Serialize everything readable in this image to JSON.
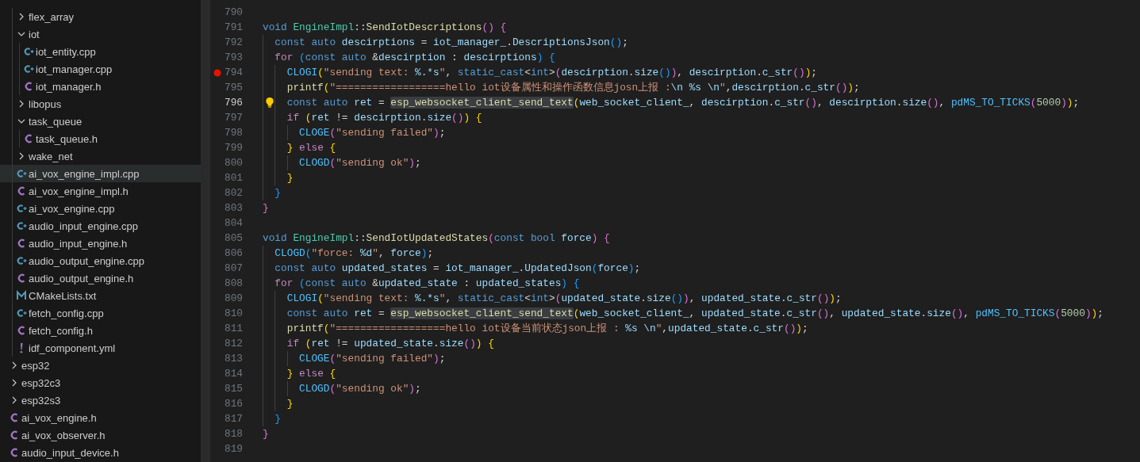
{
  "explorer": {
    "open_folder_children": [
      {
        "kind": "folder",
        "label": "flex_array",
        "expanded": false,
        "selected": false
      },
      {
        "kind": "folder",
        "label": "iot",
        "expanded": true,
        "selected": false,
        "children": [
          {
            "kind": "cpp",
            "label": "iot_entity.cpp",
            "selected": false
          },
          {
            "kind": "cpp",
            "label": "iot_manager.cpp",
            "selected": false
          },
          {
            "kind": "h",
            "label": "iot_manager.h",
            "selected": false
          }
        ]
      },
      {
        "kind": "folder",
        "label": "libopus",
        "expanded": false,
        "selected": false
      },
      {
        "kind": "folder",
        "label": "task_queue",
        "expanded": true,
        "selected": false,
        "children": [
          {
            "kind": "h",
            "label": "task_queue.h",
            "selected": false
          }
        ]
      },
      {
        "kind": "folder",
        "label": "wake_net",
        "expanded": false,
        "selected": false
      },
      {
        "kind": "cpp",
        "label": "ai_vox_engine_impl.cpp",
        "selected": true
      },
      {
        "kind": "h",
        "label": "ai_vox_engine_impl.h",
        "selected": false
      },
      {
        "kind": "cpp",
        "label": "ai_vox_engine.cpp",
        "selected": false
      },
      {
        "kind": "cpp",
        "label": "audio_input_engine.cpp",
        "selected": false
      },
      {
        "kind": "h",
        "label": "audio_input_engine.h",
        "selected": false
      },
      {
        "kind": "cpp",
        "label": "audio_output_engine.cpp",
        "selected": false
      },
      {
        "kind": "h",
        "label": "audio_output_engine.h",
        "selected": false
      },
      {
        "kind": "cmake",
        "label": "CMakeLists.txt",
        "selected": false
      },
      {
        "kind": "cpp",
        "label": "fetch_config.cpp",
        "selected": false
      },
      {
        "kind": "h",
        "label": "fetch_config.h",
        "selected": false
      },
      {
        "kind": "yml",
        "label": "idf_component.yml",
        "selected": false
      }
    ],
    "items": [
      {
        "kind": "folder",
        "label": "esp32",
        "expanded": false,
        "selected": false
      },
      {
        "kind": "folder",
        "label": "esp32c3",
        "expanded": false,
        "selected": false
      },
      {
        "kind": "folder",
        "label": "esp32s3",
        "expanded": false,
        "selected": false
      },
      {
        "kind": "h",
        "label": "ai_vox_engine.h",
        "selected": false
      },
      {
        "kind": "h",
        "label": "ai_vox_observer.h",
        "selected": false
      },
      {
        "kind": "h",
        "label": "audio_input_device.h",
        "selected": false
      }
    ]
  },
  "editor": {
    "lines": [
      {
        "n": "790",
        "breakpoint": false,
        "lightbulb": false,
        "current": false
      },
      {
        "n": "791",
        "breakpoint": false,
        "lightbulb": false,
        "current": false,
        "tokens": [
          {
            "kind": "s",
            "text": "void "
          },
          {
            "kind": "c",
            "text": "EngineImpl"
          },
          {
            "kind": "p",
            "text": "::"
          },
          {
            "kind": "f",
            "text": "SendIotDescriptions"
          },
          {
            "kind": "p",
            "text": "() {"
          }
        ]
      },
      {
        "n": "792",
        "breakpoint": false,
        "lightbulb": false,
        "current": false,
        "tokens": [
          {
            "kind": "s",
            "text": "  const "
          },
          {
            "kind": "s",
            "text": "auto "
          },
          {
            "kind": "v",
            "text": "descirptions"
          },
          {
            "kind": "p",
            "text": " = "
          },
          {
            "kind": "v",
            "text": "iot_manager_"
          },
          {
            "kind": "p",
            "text": "."
          },
          {
            "kind": "v",
            "text": "DescriptionsJson"
          },
          {
            "kind": "p",
            "text": "();"
          }
        ]
      },
      {
        "n": "793",
        "breakpoint": false,
        "lightbulb": false,
        "current": false,
        "tokens": [
          {
            "kind": "k",
            "text": "  for"
          },
          {
            "kind": "p",
            "text": " ("
          },
          {
            "kind": "s",
            "text": "const "
          },
          {
            "kind": "s",
            "text": "auto "
          },
          {
            "kind": "p",
            "text": "&"
          },
          {
            "kind": "v",
            "text": "descirption"
          },
          {
            "kind": "p",
            "text": " : "
          },
          {
            "kind": "v",
            "text": "descirptions"
          },
          {
            "kind": "p",
            "text": ") {"
          }
        ]
      },
      {
        "n": "794",
        "breakpoint": true,
        "lightbulb": false,
        "current": false,
        "tokens": [
          {
            "kind": "m",
            "text": "    CLOGI"
          },
          {
            "kind": "p",
            "text": "("
          },
          {
            "kind": "str",
            "text": "\"sending text: "
          },
          {
            "kind": "esc",
            "text": "%.*s"
          },
          {
            "kind": "str",
            "text": "\""
          },
          {
            "kind": "p",
            "text": ", "
          },
          {
            "kind": "s",
            "text": "static_cast"
          },
          {
            "kind": "p",
            "text": "<"
          },
          {
            "kind": "s",
            "text": "int"
          },
          {
            "kind": "p",
            "text": ">("
          },
          {
            "kind": "v",
            "text": "descirption"
          },
          {
            "kind": "p",
            "text": "."
          },
          {
            "kind": "v",
            "text": "size"
          },
          {
            "kind": "p",
            "text": "()), "
          },
          {
            "kind": "v",
            "text": "descirption"
          },
          {
            "kind": "p",
            "text": "."
          },
          {
            "kind": "v",
            "text": "c_str"
          },
          {
            "kind": "p",
            "text": "());"
          }
        ]
      },
      {
        "n": "795",
        "breakpoint": false,
        "lightbulb": false,
        "current": false,
        "tokens": [
          {
            "kind": "f",
            "text": "    printf"
          },
          {
            "kind": "p",
            "text": "("
          },
          {
            "kind": "str",
            "text": "\"==================hello iot设备属性和操作函数信息josn上报 :"
          },
          {
            "kind": "esc",
            "text": "\\n %s \\n"
          },
          {
            "kind": "str",
            "text": "\""
          },
          {
            "kind": "p",
            "text": ","
          },
          {
            "kind": "v",
            "text": "descirption"
          },
          {
            "kind": "p",
            "text": "."
          },
          {
            "kind": "v",
            "text": "c_str"
          },
          {
            "kind": "p",
            "text": "());"
          }
        ]
      },
      {
        "n": "796",
        "breakpoint": false,
        "lightbulb": true,
        "current": true,
        "tokens": [
          {
            "kind": "s",
            "text": "    const "
          },
          {
            "kind": "s",
            "text": "auto "
          },
          {
            "kind": "v",
            "text": "ret"
          },
          {
            "kind": "p",
            "text": " = "
          },
          {
            "kind": "h",
            "text": "esp_websocket_client_send_text"
          },
          {
            "kind": "p",
            "text": "("
          },
          {
            "kind": "v",
            "text": "web_socket_client_"
          },
          {
            "kind": "p",
            "text": ", "
          },
          {
            "kind": "v",
            "text": "descirption"
          },
          {
            "kind": "p",
            "text": "."
          },
          {
            "kind": "v",
            "text": "c_str"
          },
          {
            "kind": "p",
            "text": "(), "
          },
          {
            "kind": "v",
            "text": "descirption"
          },
          {
            "kind": "p",
            "text": "."
          },
          {
            "kind": "v",
            "text": "size"
          },
          {
            "kind": "p",
            "text": "(), "
          },
          {
            "kind": "m",
            "text": "pdMS_TO_TICKS"
          },
          {
            "kind": "p",
            "text": "("
          },
          {
            "kind": "n",
            "text": "5000"
          },
          {
            "kind": "p",
            "text": "));"
          }
        ]
      },
      {
        "n": "797",
        "breakpoint": false,
        "lightbulb": false,
        "current": false,
        "tokens": [
          {
            "kind": "k",
            "text": "    if"
          },
          {
            "kind": "p",
            "text": " ("
          },
          {
            "kind": "v",
            "text": "ret"
          },
          {
            "kind": "p",
            "text": " != "
          },
          {
            "kind": "v",
            "text": "descirption"
          },
          {
            "kind": "p",
            "text": "."
          },
          {
            "kind": "v",
            "text": "size"
          },
          {
            "kind": "p",
            "text": "()) {"
          }
        ]
      },
      {
        "n": "798",
        "breakpoint": false,
        "lightbulb": false,
        "current": false,
        "tokens": [
          {
            "kind": "m",
            "text": "      CLOGE"
          },
          {
            "kind": "p",
            "text": "("
          },
          {
            "kind": "str",
            "text": "\"sending failed\""
          },
          {
            "kind": "p",
            "text": ");"
          }
        ]
      },
      {
        "n": "799",
        "breakpoint": false,
        "lightbulb": false,
        "current": false,
        "tokens": [
          {
            "kind": "p",
            "text": "    } "
          },
          {
            "kind": "k",
            "text": "else"
          },
          {
            "kind": "p",
            "text": " {"
          }
        ]
      },
      {
        "n": "800",
        "breakpoint": false,
        "lightbulb": false,
        "current": false,
        "tokens": [
          {
            "kind": "m",
            "text": "      CLOGD"
          },
          {
            "kind": "p",
            "text": "("
          },
          {
            "kind": "str",
            "text": "\"sending ok\""
          },
          {
            "kind": "p",
            "text": ");"
          }
        ]
      },
      {
        "n": "801",
        "breakpoint": false,
        "lightbulb": false,
        "current": false,
        "tokens": [
          {
            "kind": "p",
            "text": "    }"
          }
        ]
      },
      {
        "n": "802",
        "breakpoint": false,
        "lightbulb": false,
        "current": false,
        "tokens": [
          {
            "kind": "p",
            "text": "  }"
          }
        ]
      },
      {
        "n": "803",
        "breakpoint": false,
        "lightbulb": false,
        "current": false,
        "tokens": [
          {
            "kind": "p",
            "text": "}"
          }
        ]
      },
      {
        "n": "804",
        "breakpoint": false,
        "lightbulb": false,
        "current": false
      },
      {
        "n": "805",
        "breakpoint": false,
        "lightbulb": false,
        "current": false,
        "tokens": [
          {
            "kind": "s",
            "text": "void "
          },
          {
            "kind": "c",
            "text": "EngineImpl"
          },
          {
            "kind": "p",
            "text": "::"
          },
          {
            "kind": "f",
            "text": "SendIotUpdatedStates"
          },
          {
            "kind": "p",
            "text": "("
          },
          {
            "kind": "s",
            "text": "const "
          },
          {
            "kind": "s",
            "text": "bool "
          },
          {
            "kind": "v",
            "text": "force"
          },
          {
            "kind": "p",
            "text": ") {"
          }
        ]
      },
      {
        "n": "806",
        "breakpoint": false,
        "lightbulb": false,
        "current": false,
        "tokens": [
          {
            "kind": "m",
            "text": "  CLOGD"
          },
          {
            "kind": "p",
            "text": "("
          },
          {
            "kind": "str",
            "text": "\"force: "
          },
          {
            "kind": "esc",
            "text": "%d"
          },
          {
            "kind": "str",
            "text": "\""
          },
          {
            "kind": "p",
            "text": ", "
          },
          {
            "kind": "v",
            "text": "force"
          },
          {
            "kind": "p",
            "text": ");"
          }
        ]
      },
      {
        "n": "807",
        "breakpoint": false,
        "lightbulb": false,
        "current": false,
        "tokens": [
          {
            "kind": "s",
            "text": "  const "
          },
          {
            "kind": "s",
            "text": "auto "
          },
          {
            "kind": "v",
            "text": "updated_states"
          },
          {
            "kind": "p",
            "text": " = "
          },
          {
            "kind": "v",
            "text": "iot_manager_"
          },
          {
            "kind": "p",
            "text": "."
          },
          {
            "kind": "v",
            "text": "UpdatedJson"
          },
          {
            "kind": "p",
            "text": "("
          },
          {
            "kind": "v",
            "text": "force"
          },
          {
            "kind": "p",
            "text": ");"
          }
        ]
      },
      {
        "n": "808",
        "breakpoint": false,
        "lightbulb": false,
        "current": false,
        "tokens": [
          {
            "kind": "k",
            "text": "  for"
          },
          {
            "kind": "p",
            "text": " ("
          },
          {
            "kind": "s",
            "text": "const "
          },
          {
            "kind": "s",
            "text": "auto "
          },
          {
            "kind": "p",
            "text": "&"
          },
          {
            "kind": "v",
            "text": "updated_state"
          },
          {
            "kind": "p",
            "text": " : "
          },
          {
            "kind": "v",
            "text": "updated_states"
          },
          {
            "kind": "p",
            "text": ") {"
          }
        ]
      },
      {
        "n": "809",
        "breakpoint": false,
        "lightbulb": false,
        "current": false,
        "tokens": [
          {
            "kind": "m",
            "text": "    CLOGI"
          },
          {
            "kind": "p",
            "text": "("
          },
          {
            "kind": "str",
            "text": "\"sending text: "
          },
          {
            "kind": "esc",
            "text": "%.*s"
          },
          {
            "kind": "str",
            "text": "\""
          },
          {
            "kind": "p",
            "text": ", "
          },
          {
            "kind": "s",
            "text": "static_cast"
          },
          {
            "kind": "p",
            "text": "<"
          },
          {
            "kind": "s",
            "text": "int"
          },
          {
            "kind": "p",
            "text": ">("
          },
          {
            "kind": "v",
            "text": "updated_state"
          },
          {
            "kind": "p",
            "text": "."
          },
          {
            "kind": "v",
            "text": "size"
          },
          {
            "kind": "p",
            "text": "()), "
          },
          {
            "kind": "v",
            "text": "updated_state"
          },
          {
            "kind": "p",
            "text": "."
          },
          {
            "kind": "v",
            "text": "c_str"
          },
          {
            "kind": "p",
            "text": "());"
          }
        ]
      },
      {
        "n": "810",
        "breakpoint": false,
        "lightbulb": false,
        "current": false,
        "tokens": [
          {
            "kind": "s",
            "text": "    const "
          },
          {
            "kind": "s",
            "text": "auto "
          },
          {
            "kind": "v",
            "text": "ret"
          },
          {
            "kind": "p",
            "text": " = "
          },
          {
            "kind": "h",
            "text": "esp_websocket_client_send_text"
          },
          {
            "kind": "p",
            "text": "("
          },
          {
            "kind": "v",
            "text": "web_socket_client_"
          },
          {
            "kind": "p",
            "text": ", "
          },
          {
            "kind": "v",
            "text": "updated_state"
          },
          {
            "kind": "p",
            "text": "."
          },
          {
            "kind": "v",
            "text": "c_str"
          },
          {
            "kind": "p",
            "text": "(), "
          },
          {
            "kind": "v",
            "text": "updated_state"
          },
          {
            "kind": "p",
            "text": "."
          },
          {
            "kind": "v",
            "text": "size"
          },
          {
            "kind": "p",
            "text": "(), "
          },
          {
            "kind": "m",
            "text": "pdMS_TO_TICKS"
          },
          {
            "kind": "p",
            "text": "("
          },
          {
            "kind": "n",
            "text": "5000"
          },
          {
            "kind": "p",
            "text": "));"
          }
        ]
      },
      {
        "n": "811",
        "breakpoint": false,
        "lightbulb": false,
        "current": false,
        "tokens": [
          {
            "kind": "f",
            "text": "    printf"
          },
          {
            "kind": "p",
            "text": "("
          },
          {
            "kind": "str",
            "text": "\"==================hello iot设备当前状态json上报 : "
          },
          {
            "kind": "esc",
            "text": "%s \\n"
          },
          {
            "kind": "str",
            "text": "\""
          },
          {
            "kind": "p",
            "text": ","
          },
          {
            "kind": "v",
            "text": "updated_state"
          },
          {
            "kind": "p",
            "text": "."
          },
          {
            "kind": "v",
            "text": "c_str"
          },
          {
            "kind": "p",
            "text": "());"
          }
        ]
      },
      {
        "n": "812",
        "breakpoint": false,
        "lightbulb": false,
        "current": false,
        "tokens": [
          {
            "kind": "k",
            "text": "    if"
          },
          {
            "kind": "p",
            "text": " ("
          },
          {
            "kind": "v",
            "text": "ret"
          },
          {
            "kind": "p",
            "text": " != "
          },
          {
            "kind": "v",
            "text": "updated_state"
          },
          {
            "kind": "p",
            "text": "."
          },
          {
            "kind": "v",
            "text": "size"
          },
          {
            "kind": "p",
            "text": "()) {"
          }
        ]
      },
      {
        "n": "813",
        "breakpoint": false,
        "lightbulb": false,
        "current": false,
        "tokens": [
          {
            "kind": "m",
            "text": "      CLOGE"
          },
          {
            "kind": "p",
            "text": "("
          },
          {
            "kind": "str",
            "text": "\"sending failed\""
          },
          {
            "kind": "p",
            "text": ");"
          }
        ]
      },
      {
        "n": "814",
        "breakpoint": false,
        "lightbulb": false,
        "current": false,
        "tokens": [
          {
            "kind": "p",
            "text": "    } "
          },
          {
            "kind": "k",
            "text": "else"
          },
          {
            "kind": "p",
            "text": " {"
          }
        ]
      },
      {
        "n": "815",
        "breakpoint": false,
        "lightbulb": false,
        "current": false,
        "tokens": [
          {
            "kind": "m",
            "text": "      CLOGD"
          },
          {
            "kind": "p",
            "text": "("
          },
          {
            "kind": "str",
            "text": "\"sending ok\""
          },
          {
            "kind": "p",
            "text": ");"
          }
        ]
      },
      {
        "n": "816",
        "breakpoint": false,
        "lightbulb": false,
        "current": false,
        "tokens": [
          {
            "kind": "p",
            "text": "    }"
          }
        ]
      },
      {
        "n": "817",
        "breakpoint": false,
        "lightbulb": false,
        "current": false,
        "tokens": [
          {
            "kind": "p",
            "text": "  }"
          }
        ]
      },
      {
        "n": "818",
        "breakpoint": false,
        "lightbulb": false,
        "current": false,
        "tokens": [
          {
            "kind": "p",
            "text": "}"
          }
        ]
      },
      {
        "n": "819",
        "breakpoint": false,
        "lightbulb": false,
        "current": false
      }
    ]
  }
}
